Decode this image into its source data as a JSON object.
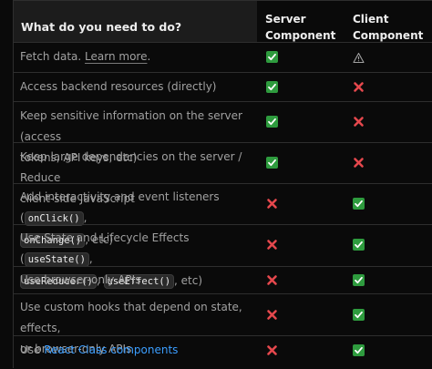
{
  "header": {
    "question": "What do you need to do?",
    "server_line1": "Server",
    "server_line2": "Component",
    "client_line1": "Client",
    "client_line2": "Component"
  },
  "rows": [
    {
      "text_before": "Fetch data.",
      "link": "Learn more",
      "text_after": ".",
      "server": "check",
      "client": "warning"
    },
    {
      "text": "Access backend resources (directly)",
      "server": "check",
      "client": "cross"
    },
    {
      "line1": "Keep sensitive information on the server (access",
      "line2": "tokens, API keys, etc)",
      "server": "check",
      "client": "cross"
    },
    {
      "line1": "Keep large dependencies on the server / Reduce",
      "line2": "client-side JavaScript",
      "server": "check",
      "client": "cross"
    },
    {
      "line1_before": "Add interactivity and event listeners (",
      "code1": "onClick()",
      "line1_after": ",",
      "code2": "onChange()",
      "line2_after": ", etc)",
      "server": "cross",
      "client": "check"
    },
    {
      "line1_before": "Use State and Lifecycle Effects (",
      "code1": "useState()",
      "line1_after": ",",
      "code2": "useReducer()",
      "sep": ", ",
      "code3": "useEffect()",
      "line2_after": ", etc)",
      "server": "cross",
      "client": "check"
    },
    {
      "text": "Use browser-only APIs",
      "server": "cross",
      "client": "check"
    },
    {
      "line1": "Use custom hooks that depend on state, effects,",
      "line2": "or browser-only APIs",
      "server": "cross",
      "client": "check"
    },
    {
      "text_before": "Use ",
      "link": "React Class components",
      "server": "cross",
      "client": "check"
    }
  ],
  "colors": {
    "check_bg": "#2e9b3e",
    "cross": "#e5484d",
    "link": "#3b9eff"
  }
}
